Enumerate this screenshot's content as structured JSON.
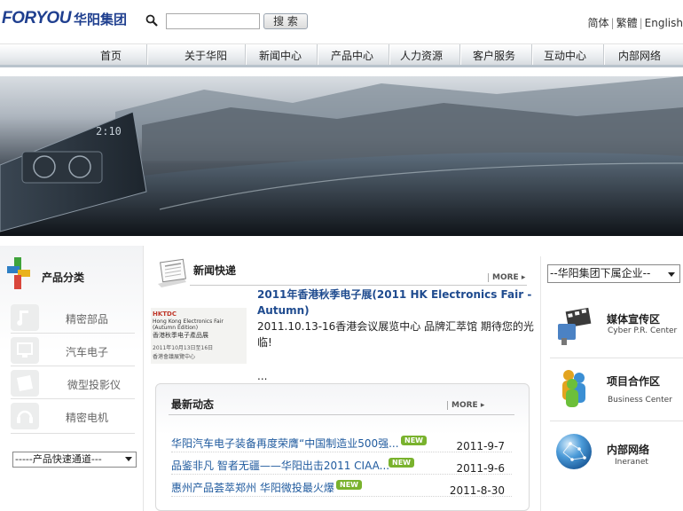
{
  "header": {
    "logo_en": "FORYOU",
    "logo_cn": "华阳集团",
    "search_placeholder": "",
    "search_button": "搜 索",
    "lang_simplified": "简体",
    "lang_traditional": "繁體",
    "lang_english": "English"
  },
  "nav": {
    "items": [
      "首页",
      "关于华阳",
      "新闻中心",
      "产品中心",
      "人力资源",
      "客户服务",
      "互动中心",
      "内部网络"
    ]
  },
  "left": {
    "title": "产品分类",
    "categories": [
      {
        "label": "精密部品",
        "icon": "precision-parts-icon"
      },
      {
        "label": "汽车电子",
        "icon": "auto-electronics-icon"
      },
      {
        "label": "微型投影仪",
        "icon": "micro-projector-icon"
      },
      {
        "label": "精密电机",
        "icon": "precision-motor-icon"
      }
    ],
    "quick_select": "-----产品快速通道---"
  },
  "news": {
    "section_title": "新闻快递",
    "more": "MORE",
    "headline": "2011年香港秋季电子展(2011 HK Electronics Fair - Autumn)",
    "summary": "2011.10.13-16香港会议展览中心 品牌汇萃馆  期待您的光临!",
    "ellipsis": "...",
    "thumb": {
      "line1": "HKTDC",
      "line2": "Hong Kong Electronics Fair (Autumn Edition)",
      "line3": "香港秋季电子產品展",
      "line4": "2011年10月13日至16日",
      "line5": "香港會議展覽中心"
    }
  },
  "latest": {
    "title": "最新动态",
    "more": "MORE",
    "badge": "NEW",
    "items": [
      {
        "title": "华阳汽车电子装备再度荣膺“中国制造业500强...",
        "date": "2011-9-7"
      },
      {
        "title": "品鉴非凡  智者无疆——华阳出击2011 CIAA...",
        "date": "2011-9-6"
      },
      {
        "title": "惠州产品荟萃郑州 华阳微投最火爆",
        "date": "2011-8-30"
      }
    ]
  },
  "right": {
    "group_select": "--华阳集团下属企业--",
    "items": [
      {
        "title": "媒体宣传区",
        "subtitle": "Cyber P.R. Center",
        "icon": "film-media-icon"
      },
      {
        "title": "项目合作区",
        "subtitle": "Business Center",
        "icon": "people-cooperation-icon"
      },
      {
        "title": "内部网络",
        "subtitle": "Ineranet",
        "icon": "globe-network-icon"
      }
    ]
  },
  "colors": {
    "brand": "#1f3f8f",
    "link": "#1f5a9e",
    "new_badge": "#79b22d"
  }
}
